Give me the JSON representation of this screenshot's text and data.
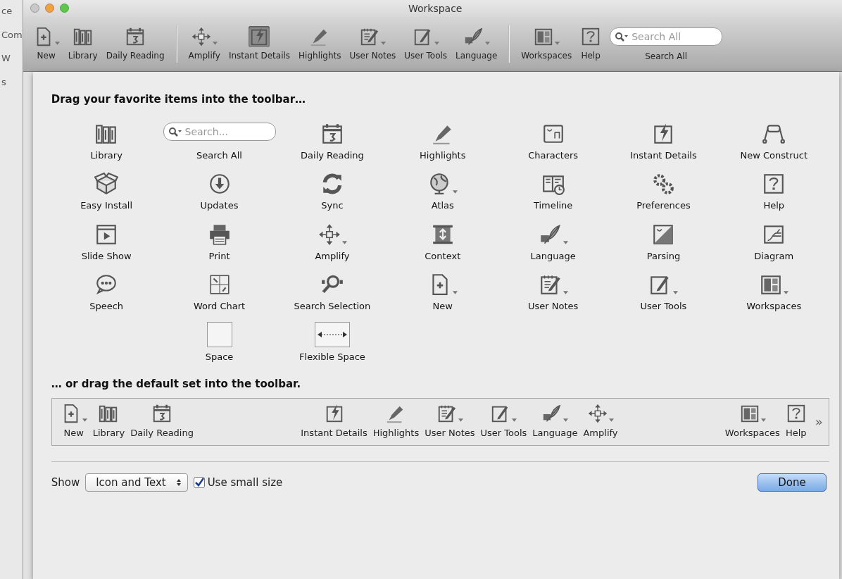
{
  "background_window": {
    "fragments": [
      "ce",
      "Com",
      "W",
      "s"
    ]
  },
  "window": {
    "title": "Workspace"
  },
  "toolbar": [
    {
      "kind": "button",
      "label": "New",
      "menu": true,
      "selected": false
    },
    {
      "kind": "button",
      "label": "Library",
      "menu": false,
      "selected": false
    },
    {
      "kind": "button",
      "label": "Daily Reading",
      "menu": false,
      "selected": false
    },
    {
      "kind": "separator"
    },
    {
      "kind": "button",
      "label": "Amplify",
      "menu": true,
      "selected": false
    },
    {
      "kind": "button",
      "label": "Instant Details",
      "menu": false,
      "selected": true
    },
    {
      "kind": "button",
      "label": "Highlights",
      "menu": false,
      "selected": false
    },
    {
      "kind": "button",
      "label": "User Notes",
      "menu": true,
      "selected": false
    },
    {
      "kind": "button",
      "label": "User Tools",
      "menu": true,
      "selected": false
    },
    {
      "kind": "button",
      "label": "Language",
      "menu": true,
      "selected": false
    },
    {
      "kind": "separator"
    },
    {
      "kind": "button",
      "label": "Workspaces",
      "menu": true,
      "selected": false
    },
    {
      "kind": "button",
      "label": "Help",
      "menu": false,
      "selected": false
    },
    {
      "kind": "search",
      "label": "Search All",
      "placeholder": "Search All"
    }
  ],
  "sheet": {
    "heading": "Drag your favorite items into the toolbar…",
    "palette_rows": [
      [
        {
          "kind": "button",
          "label": "Library",
          "menu": false
        },
        {
          "kind": "search",
          "label": "Search All",
          "placeholder": "Search..."
        },
        {
          "kind": "button",
          "label": "Daily Reading",
          "menu": false
        },
        {
          "kind": "button",
          "label": "Highlights",
          "menu": false
        },
        {
          "kind": "button",
          "label": "Characters",
          "menu": false
        },
        {
          "kind": "button",
          "label": "Instant Details",
          "menu": false
        },
        {
          "kind": "button",
          "label": "New Construct",
          "menu": false
        }
      ],
      [
        {
          "kind": "button",
          "label": "Easy Install",
          "menu": false
        },
        {
          "kind": "button",
          "label": "Updates",
          "menu": false
        },
        {
          "kind": "button",
          "label": "Sync",
          "menu": false
        },
        {
          "kind": "button",
          "label": "Atlas",
          "menu": true
        },
        {
          "kind": "button",
          "label": "Timeline",
          "menu": false
        },
        {
          "kind": "button",
          "label": "Preferences",
          "menu": false
        },
        {
          "kind": "button",
          "label": "Help",
          "menu": false
        }
      ],
      [
        {
          "kind": "button",
          "label": "Slide Show",
          "menu": false
        },
        {
          "kind": "button",
          "label": "Print",
          "menu": false
        },
        {
          "kind": "button",
          "label": "Amplify",
          "menu": true
        },
        {
          "kind": "button",
          "label": "Context",
          "menu": false
        },
        {
          "kind": "button",
          "label": "Language",
          "menu": true
        },
        {
          "kind": "button",
          "label": "Parsing",
          "menu": false
        },
        {
          "kind": "button",
          "label": "Diagram",
          "menu": false
        }
      ],
      [
        {
          "kind": "button",
          "label": "Speech",
          "menu": false
        },
        {
          "kind": "button",
          "label": "Word Chart",
          "menu": false
        },
        {
          "kind": "button",
          "label": "Search Selection",
          "menu": false
        },
        {
          "kind": "button",
          "label": "New",
          "menu": true
        },
        {
          "kind": "button",
          "label": "User Notes",
          "menu": true
        },
        {
          "kind": "button",
          "label": "User Tools",
          "menu": true
        },
        {
          "kind": "button",
          "label": "Workspaces",
          "menu": true
        }
      ],
      [
        {
          "kind": "space",
          "label": "Space"
        },
        {
          "kind": "flexspace",
          "label": "Flexible Space"
        }
      ]
    ],
    "default_heading": "… or drag the default set into the toolbar.",
    "default_set": [
      {
        "kind": "button",
        "label": "New",
        "menu": true
      },
      {
        "kind": "button",
        "label": "Library",
        "menu": false
      },
      {
        "kind": "button",
        "label": "Daily Reading",
        "menu": false
      },
      {
        "kind": "gap"
      },
      {
        "kind": "button",
        "label": "Instant Details",
        "menu": false
      },
      {
        "kind": "button",
        "label": "Highlights",
        "menu": false
      },
      {
        "kind": "button",
        "label": "User Notes",
        "menu": true
      },
      {
        "kind": "button",
        "label": "User Tools",
        "menu": true
      },
      {
        "kind": "button",
        "label": "Language",
        "menu": true
      },
      {
        "kind": "button",
        "label": "Amplify",
        "menu": true
      },
      {
        "kind": "gap"
      },
      {
        "kind": "button",
        "label": "Workspaces",
        "menu": true
      },
      {
        "kind": "button",
        "label": "Help",
        "menu": false
      }
    ],
    "overflow": "»",
    "show_label": "Show",
    "show_value": "Icon and Text",
    "small_size": {
      "label": "Use small size",
      "checked": true
    },
    "done": "Done"
  }
}
